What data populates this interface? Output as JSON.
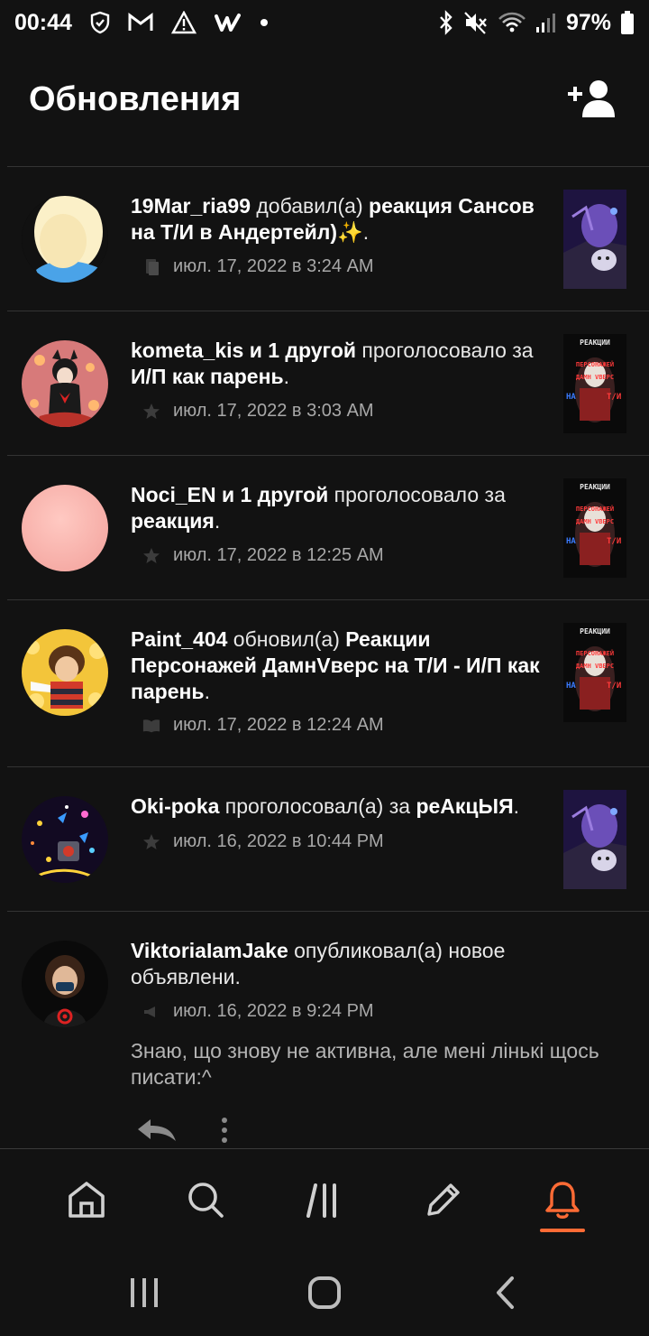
{
  "status_bar": {
    "time": "00:44",
    "battery": "97%"
  },
  "header": {
    "title": "Обновления"
  },
  "feed": [
    {
      "user": "19Mar_ria99",
      "action": " добавил(а) ",
      "target": "реакция Сансов на Т/И в Андертейл)",
      "suffix": "✨.",
      "date": "июл. 17, 2022 в 3:24 AM",
      "meta_icon": "library-icon"
    },
    {
      "user": "kometa_kis и 1 другой",
      "action": " проголосовало за ",
      "target": "И/П как парень",
      "suffix": ".",
      "date": "июл. 17, 2022 в 3:03 AM",
      "meta_icon": "star-icon"
    },
    {
      "user": "Noci_EN и 1 другой",
      "action": " проголосовало за ",
      "target": "реакция",
      "suffix": ".",
      "date": "июл. 17, 2022 в 12:25 AM",
      "meta_icon": "star-icon"
    },
    {
      "user": "Paint_404",
      "action": " обновил(а) ",
      "target": "Реакции Персонажей ДамнVверс на Т/И - И/П как парень",
      "suffix": ".",
      "date": "июл. 17, 2022 в 12:24 AM",
      "meta_icon": "book-icon"
    },
    {
      "user": "Oki-poka",
      "action": " проголосовал(а) за ",
      "target": "реАкцЫЯ",
      "suffix": ".",
      "date": "июл. 16, 2022 в 10:44 PM",
      "meta_icon": "star-icon"
    },
    {
      "user": "ViktoriaIamJake",
      "action": " опубликовал(а) новое объявлени.",
      "target": "",
      "suffix": "",
      "date": "июл. 16, 2022 в 9:24 PM",
      "meta_icon": "megaphone-icon",
      "message": "Знаю, що знову не активна, але мені лінькі щось писати:^"
    }
  ],
  "thumb_text": {
    "line1": "РЕАКЦИИ",
    "line2": "ПЕРСОНАЖЕЙ",
    "line3": "ДАМН VВЕРС",
    "line4a": "НА",
    "line4b": "Т/И"
  },
  "bottom_nav": [
    "home",
    "search",
    "library",
    "write",
    "notifications"
  ],
  "active_tab": "notifications",
  "colors": {
    "background": "#121212",
    "accent": "#ff6b35",
    "divider": "#333333",
    "secondary_text": "#a8a8a8"
  }
}
